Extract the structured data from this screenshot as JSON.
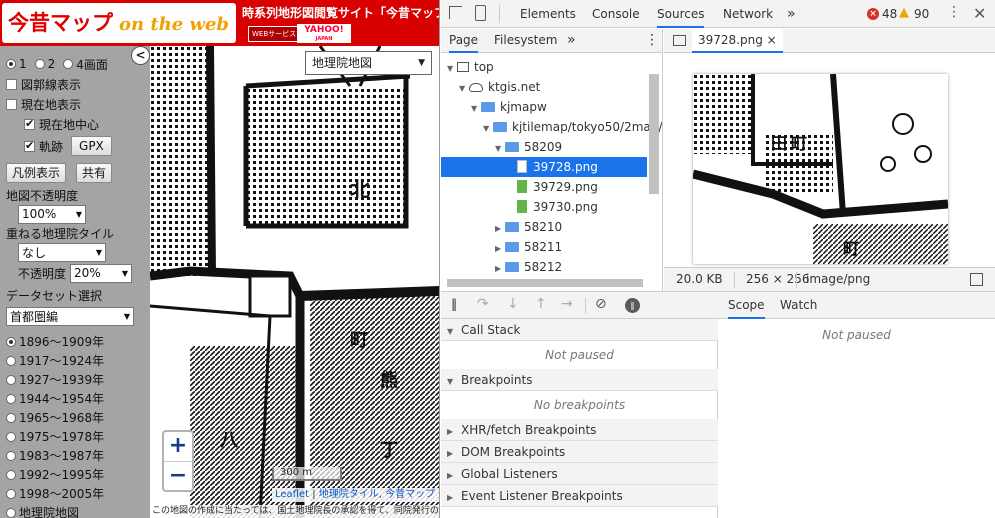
{
  "site": {
    "logo_jp": "今昔マップ",
    "logo_en": "on the web",
    "tagline": "時系列地形図閲覧サイト「今昔マップ",
    "badge_web": "WEBサービス",
    "badge_yahoo": "YAHOO!",
    "badge_yahoo_sub": "JAPAN"
  },
  "panel": {
    "screens": [
      {
        "label": "1",
        "selected": true
      },
      {
        "label": "2",
        "selected": false
      },
      {
        "label": "4画面",
        "selected": false
      }
    ],
    "toggles": {
      "grid_lines": "図郭線表示",
      "current_location": "現在地表示",
      "center_current": "現在地中心",
      "track": "軌跡",
      "gpx_button": "GPX"
    },
    "legend_button": "凡例表示",
    "share_button": "共有",
    "map_opacity_label": "地図不透明度",
    "map_opacity_value": "100%",
    "overlay_tile_label": "重ねる地理院タイル",
    "overlay_tile_value": "なし",
    "overlay_opacity_label": "不透明度",
    "overlay_opacity_value": "20%",
    "dataset_label": "データセット選択",
    "dataset_value": "首都圏編",
    "periods": [
      {
        "label": "1896～1909年",
        "selected": true
      },
      {
        "label": "1917～1924年",
        "selected": false
      },
      {
        "label": "1927～1939年",
        "selected": false
      },
      {
        "label": "1944～1954年",
        "selected": false
      },
      {
        "label": "1965～1968年",
        "selected": false
      },
      {
        "label": "1975～1978年",
        "selected": false
      },
      {
        "label": "1983～1987年",
        "selected": false
      },
      {
        "label": "1992～1995年",
        "selected": false
      },
      {
        "label": "1998～2005年",
        "selected": false
      },
      {
        "label": "地理院地図",
        "selected": false
      }
    ]
  },
  "map": {
    "collapse_glyph": "<",
    "map_type": "地理院地図",
    "zoom_in": "+",
    "zoom_out": "−",
    "scale": "300 m",
    "attribution_leaflet": "Leaflet",
    "attribution_sep": " | ",
    "attribution_gsi": "地理院タイル",
    "attribution_sep2": ", ",
    "attribution_konjaku": "今昔マップ",
    "footer_note": "この地図の作成に当たっては、国土地理院長の承認を得て、同院発行の"
  },
  "devtools": {
    "tabs": [
      "Elements",
      "Console",
      "Sources",
      "Network"
    ],
    "active_tab": "Sources",
    "more": "»",
    "error_count": "48",
    "warning_count": "90",
    "navigator_tabs": [
      "Page",
      "Filesystem"
    ],
    "navigator_more": "»",
    "tree": [
      {
        "label": "top",
        "kind": "frame",
        "depth": 0,
        "arrow": "▼"
      },
      {
        "label": "ktgis.net",
        "kind": "cloud",
        "depth": 1,
        "arrow": "▼"
      },
      {
        "label": "kjmapw",
        "kind": "folder",
        "depth": 2,
        "arrow": "▼"
      },
      {
        "label": "kjtilemap/tokyo50/2man/",
        "kind": "folder",
        "depth": 3,
        "arrow": "▼"
      },
      {
        "label": "58209",
        "kind": "folder",
        "depth": 4,
        "arrow": "▼"
      },
      {
        "label": "39728.png",
        "kind": "file-selected",
        "depth": 5,
        "arrow": ""
      },
      {
        "label": "39729.png",
        "kind": "file",
        "depth": 5,
        "arrow": ""
      },
      {
        "label": "39730.png",
        "kind": "file",
        "depth": 5,
        "arrow": ""
      },
      {
        "label": "58210",
        "kind": "folder",
        "depth": 4,
        "arrow": "▶"
      },
      {
        "label": "58211",
        "kind": "folder",
        "depth": 4,
        "arrow": "▶"
      },
      {
        "label": "58212",
        "kind": "folder",
        "depth": 4,
        "arrow": "▶"
      }
    ],
    "editor_tab": "39728.png",
    "editor_tab_close": "×",
    "image_size": "20.0 KB",
    "image_dims": "256 × 256",
    "image_type": "image/png",
    "sections": [
      {
        "title": "Call Stack",
        "empty": "Not paused"
      },
      {
        "title": "Breakpoints",
        "empty": "No breakpoints"
      },
      {
        "title": "XHR/fetch Breakpoints",
        "empty": ""
      },
      {
        "title": "DOM Breakpoints",
        "empty": ""
      },
      {
        "title": "Global Listeners",
        "empty": ""
      },
      {
        "title": "Event Listener Breakpoints",
        "empty": ""
      }
    ],
    "scope_tabs": [
      "Scope",
      "Watch"
    ],
    "scope_empty": "Not paused"
  }
}
